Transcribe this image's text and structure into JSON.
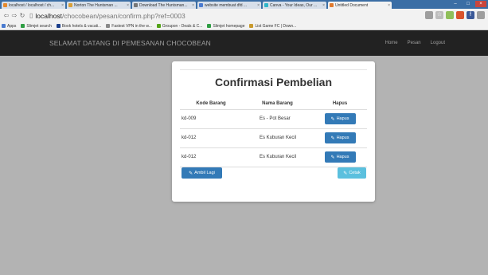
{
  "browser": {
    "tabs": [
      {
        "label": "localhost / localhost / ch...",
        "color": "#e68a2e"
      },
      {
        "label": "Norton The Huntsman ...",
        "color": "#d9a03a"
      },
      {
        "label": "Download The Huntsman...",
        "color": "#777777"
      },
      {
        "label": "website membuat dfd ...",
        "color": "#4a7bd0"
      },
      {
        "label": "Canva - Your Ideas, Our ...",
        "color": "#2fb5c9"
      },
      {
        "label": "Untitled Document",
        "color": "#e07a2e"
      }
    ],
    "url_host": "localhost",
    "url_path": "/chocobean/pesan/confirm.php?ref=0003",
    "bookmarks": [
      {
        "label": "Apps",
        "color": "#4a7bd0"
      },
      {
        "label": "Slimjet search",
        "color": "#2f9e44"
      },
      {
        "label": "Book hotels & vacati...",
        "color": "#1c3f8c"
      },
      {
        "label": "Fastest VPN in the w...",
        "color": "#888888"
      },
      {
        "label": "Groupon - Deals & C...",
        "color": "#53a318"
      },
      {
        "label": "Slimjet homepage",
        "color": "#2f9e44"
      },
      {
        "label": "List Game FC | Down...",
        "color": "#c99a2e"
      }
    ]
  },
  "navbar": {
    "brand": "SELAMAT DATANG DI PEMESANAN CHOCOBEAN",
    "links": [
      "Home",
      "Pesan",
      "Logout"
    ]
  },
  "card": {
    "title": "Confirmasi Pembelian",
    "columns": [
      "Kode Barang",
      "Nama Barang",
      "Hapus"
    ],
    "rows": [
      {
        "kode": "kd-009",
        "nama": "Es - Pot Besar",
        "action": "Hapus"
      },
      {
        "kode": "kd-012",
        "nama": "Es Kuburan Kecil",
        "action": "Hapus"
      },
      {
        "kode": "kd-012",
        "nama": "Es Kuburan Kecil",
        "action": "Hapus"
      }
    ],
    "ambil_label": "Ambil Lagi",
    "cetak_label": "Cetak"
  },
  "colors": {
    "primary": "#337ab7",
    "info": "#5bc0de",
    "navbar": "#222222",
    "background": "#b3b3b3"
  }
}
